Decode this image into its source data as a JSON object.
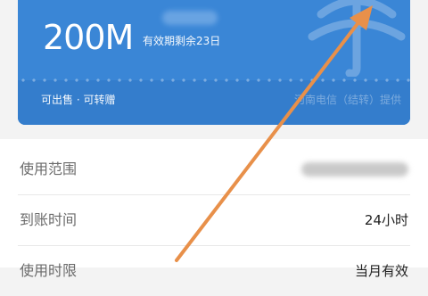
{
  "card": {
    "data_amount": "200M",
    "validity": "有效期剩余23日",
    "tags": "可出售 · 可转赠",
    "provider": "河南电信（结转）提供"
  },
  "details": {
    "rows": [
      {
        "label": "使用范围",
        "value": ""
      },
      {
        "label": "到账时间",
        "value": "24小时"
      },
      {
        "label": "使用时限",
        "value": "当月有效"
      }
    ]
  },
  "colors": {
    "card_blue": "#3a86d6",
    "arrow_orange": "#e8904a"
  },
  "icons": {
    "logo": "china-telecom-logo-icon",
    "arrow": "annotation-arrow-icon"
  }
}
